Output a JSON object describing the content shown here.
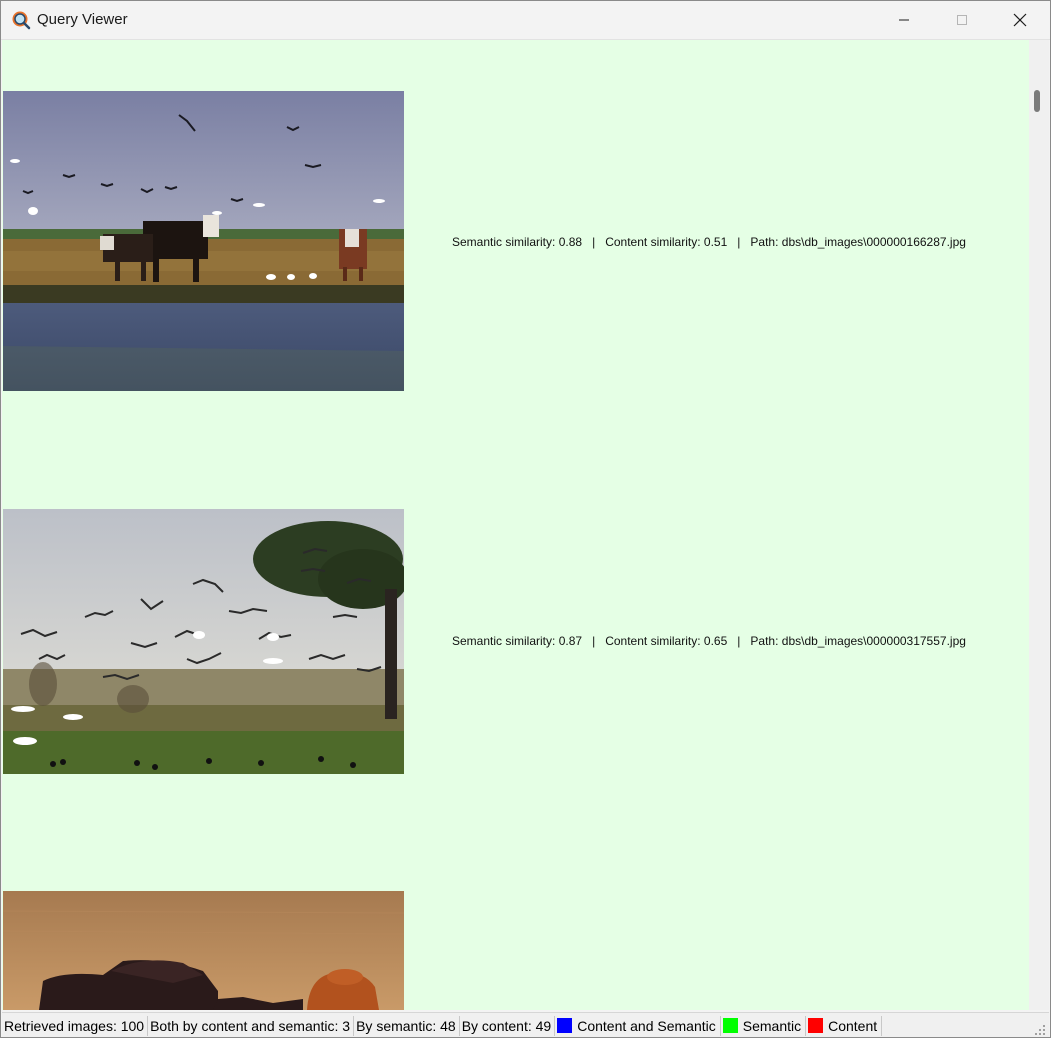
{
  "window": {
    "title": "Query Viewer"
  },
  "results": [
    {
      "semantic_label": "Semantic similarity: 0.88",
      "content_label": "Content similarity: 0.51",
      "path_label": "Path: dbs\\db_images\\000000166287.jpg"
    },
    {
      "semantic_label": "Semantic similarity: 0.87",
      "content_label": "Content similarity: 0.65",
      "path_label": "Path: dbs\\db_images\\000000317557.jpg"
    }
  ],
  "separator": "|",
  "status": {
    "retrieved": "Retrieved images: 100",
    "both": "Both by content and semantic: 3",
    "by_semantic": "By semantic: 48",
    "by_content": "By content: 49",
    "legend": [
      {
        "label": "Content and Semantic",
        "color": "#0000ff"
      },
      {
        "label": "Semantic",
        "color": "#00ff00"
      },
      {
        "label": "Content",
        "color": "#ff0000"
      }
    ]
  }
}
